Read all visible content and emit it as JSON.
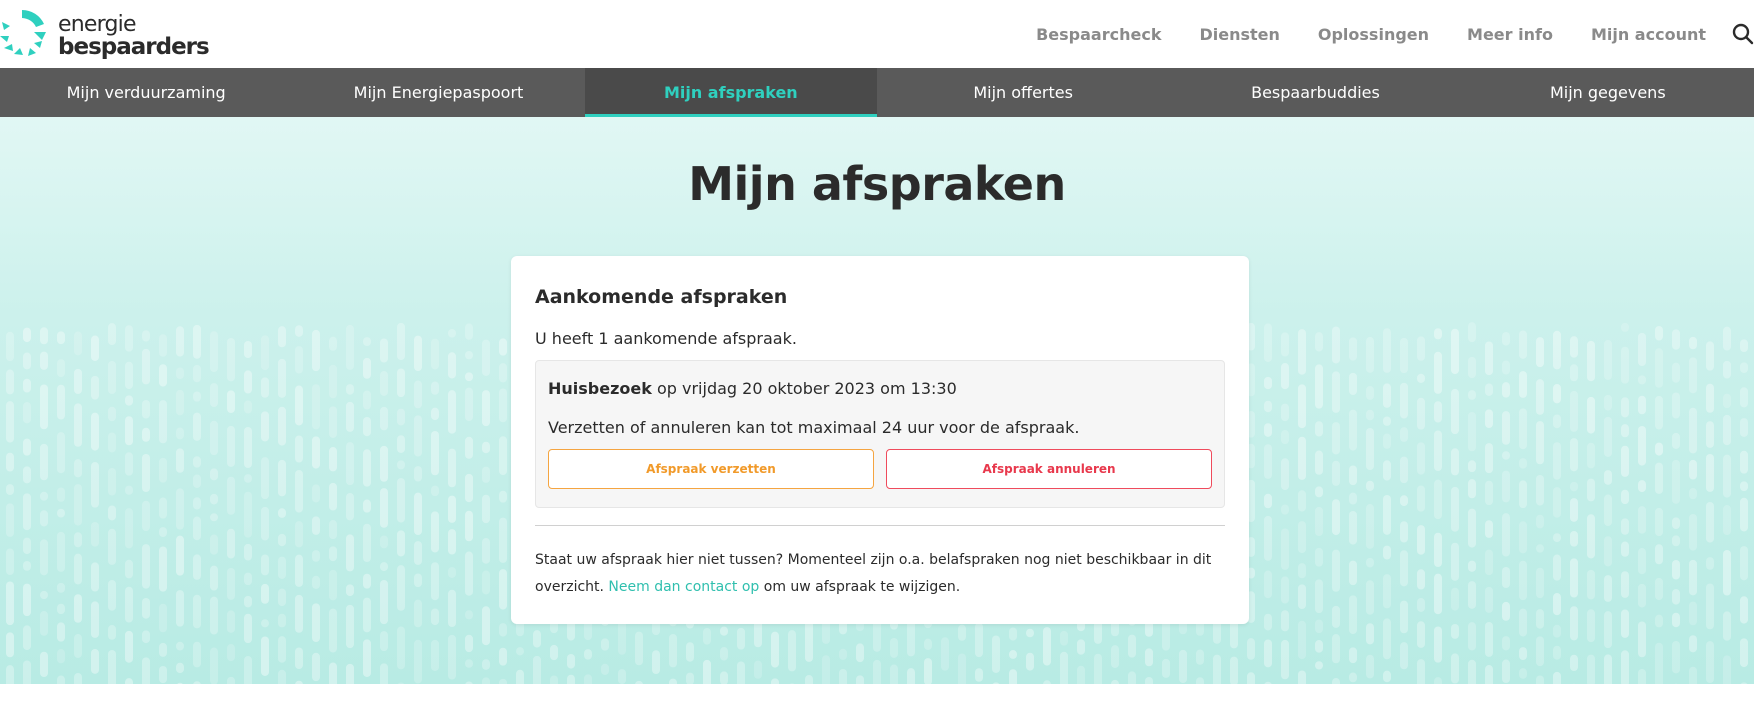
{
  "brand": {
    "line1": "energie",
    "line2": "bespaarders",
    "accent_color": "#2fd0bf"
  },
  "topnav": {
    "items": [
      "Bespaarcheck",
      "Diensten",
      "Oplossingen",
      "Meer info",
      "Mijn account"
    ],
    "search_icon": "search-icon"
  },
  "tabs": {
    "items": [
      "Mijn verduurzaming",
      "Mijn Energiepaspoort",
      "Mijn afspraken",
      "Mijn offertes",
      "Bespaarbuddies",
      "Mijn gegevens"
    ],
    "active": "Mijn afspraken"
  },
  "page": {
    "title": "Mijn afspraken"
  },
  "card": {
    "title": "Aankomende afspraken",
    "count_text": "U heeft 1 aankomende afspraak.",
    "appointment": {
      "type": "Huisbezoek",
      "when": " op vrijdag 20 oktober 2023 om 13:30",
      "note": "Verzetten of annuleren kan tot maximaal 24 uur voor de afspraak.",
      "move_label": "Afspraak verzetten",
      "cancel_label": "Afspraak annuleren"
    },
    "footnote": {
      "before": "Staat uw afspraak hier niet tussen? Momenteel zijn o.a. belafspraken nog niet beschikbaar in dit overzicht. ",
      "link": "Neem dan contact op",
      "after": " om uw afspraak te wijzigen."
    }
  },
  "colors": {
    "tabbar": "#5a5a5a",
    "move_button": "#f19a2a",
    "cancel_button": "#e8384c",
    "link": "#2fbfae"
  }
}
